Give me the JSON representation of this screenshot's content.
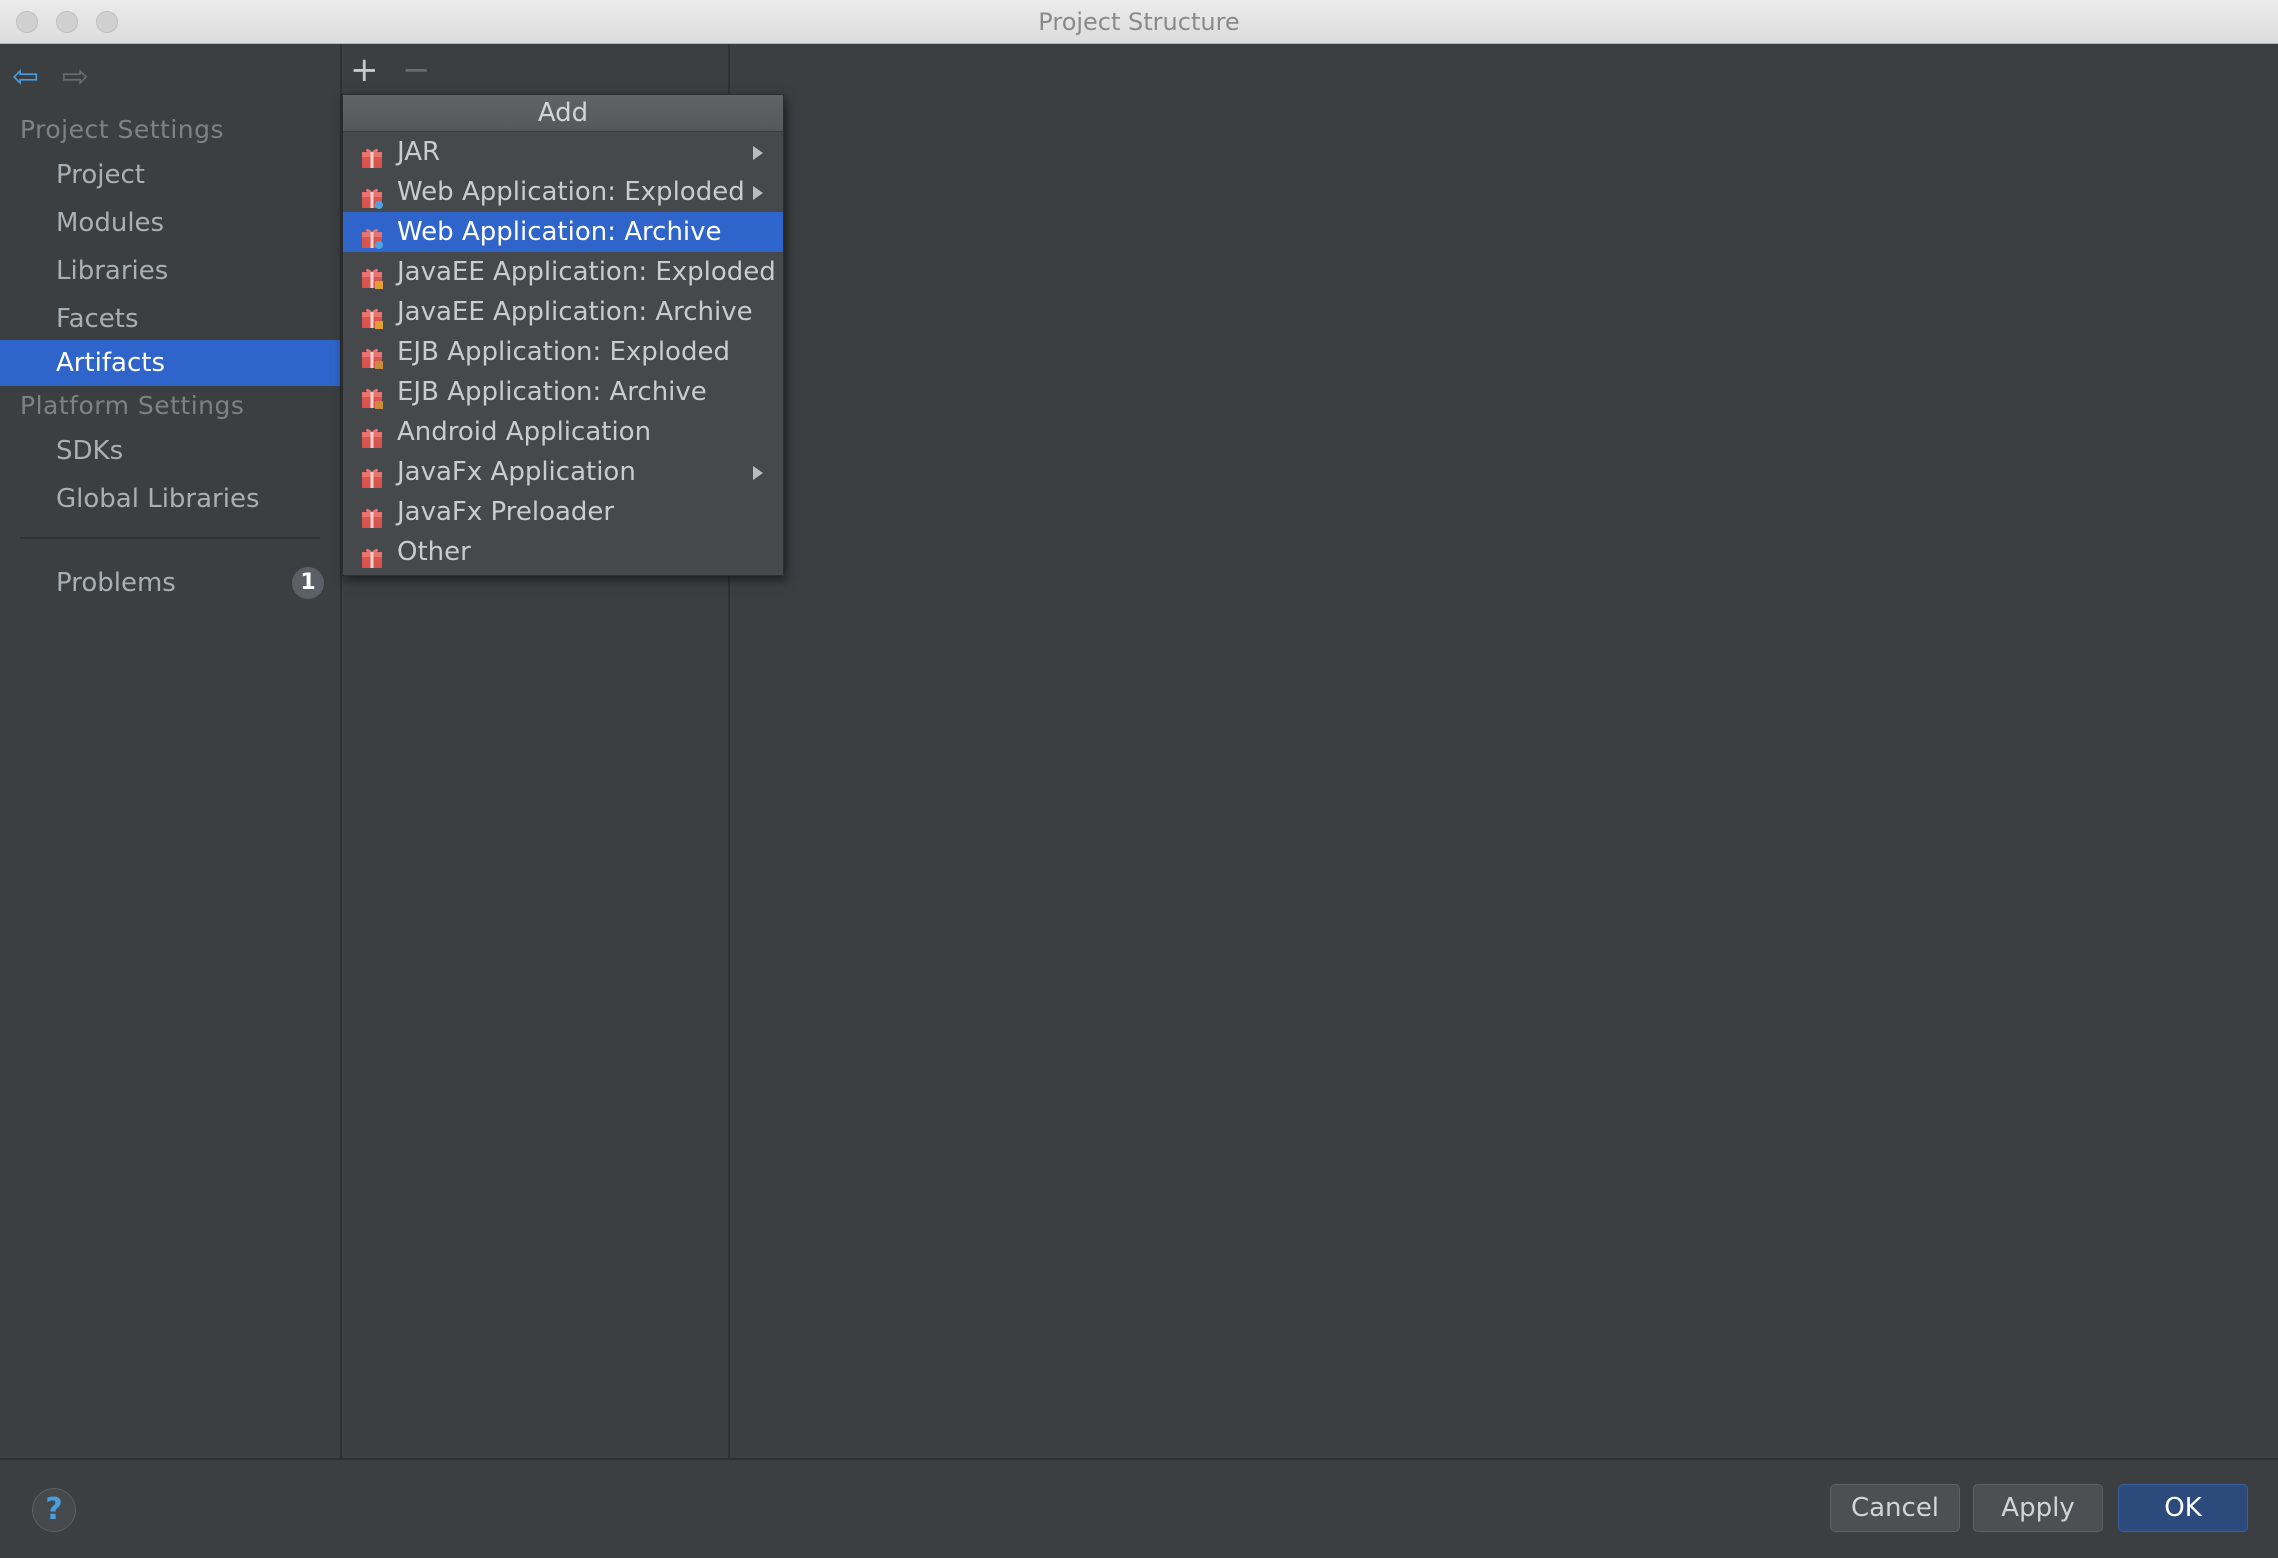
{
  "window": {
    "title": "Project Structure"
  },
  "sidebar": {
    "project_settings_header": "Project Settings",
    "project_items": [
      {
        "label": "Project"
      },
      {
        "label": "Modules"
      },
      {
        "label": "Libraries"
      },
      {
        "label": "Facets"
      },
      {
        "label": "Artifacts",
        "selected": true
      }
    ],
    "platform_settings_header": "Platform Settings",
    "platform_items": [
      {
        "label": "SDKs"
      },
      {
        "label": "Global Libraries"
      }
    ],
    "problems": {
      "label": "Problems",
      "count": "1"
    }
  },
  "toolbar": {
    "add_icon": "plus-icon",
    "remove_icon": "minus-icon"
  },
  "popup": {
    "title": "Add",
    "items": [
      {
        "label": "JAR",
        "submenu": true,
        "icon": "artifact-icon"
      },
      {
        "label": "Web Application: Exploded",
        "submenu": true,
        "icon": "web-artifact-icon"
      },
      {
        "label": "Web Application: Archive",
        "submenu": false,
        "highlighted": true,
        "icon": "web-artifact-icon"
      },
      {
        "label": "JavaEE Application: Exploded",
        "submenu": false,
        "icon": "javaee-artifact-icon"
      },
      {
        "label": "JavaEE Application: Archive",
        "submenu": false,
        "icon": "javaee-artifact-icon"
      },
      {
        "label": "EJB Application: Exploded",
        "submenu": false,
        "icon": "ejb-artifact-icon"
      },
      {
        "label": "EJB Application: Archive",
        "submenu": false,
        "icon": "ejb-artifact-icon"
      },
      {
        "label": "Android Application",
        "submenu": false,
        "icon": "artifact-icon"
      },
      {
        "label": "JavaFx Application",
        "submenu": true,
        "icon": "artifact-icon"
      },
      {
        "label": "JavaFx Preloader",
        "submenu": false,
        "icon": "artifact-icon"
      },
      {
        "label": "Other",
        "submenu": false,
        "icon": "artifact-icon"
      }
    ]
  },
  "footer": {
    "help": "?",
    "cancel_label": "Cancel",
    "apply_label": "Apply",
    "ok_label": "OK"
  },
  "colors": {
    "selection": "#2f65ca",
    "background": "#3c3f41",
    "accent_blue": "#4a9ee0"
  }
}
